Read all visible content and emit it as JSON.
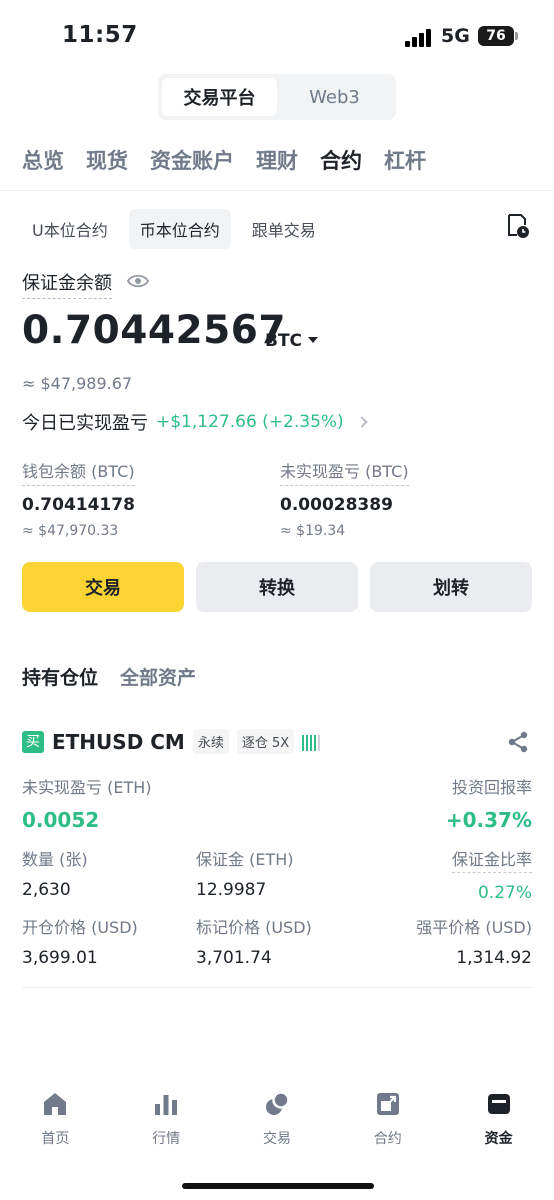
{
  "status_bar": {
    "time": "11:57",
    "network": "5G",
    "battery": "76"
  },
  "platform_switch": {
    "tabs": [
      "交易平台",
      "Web3"
    ],
    "active": 0
  },
  "main_nav": {
    "items": [
      "总览",
      "现货",
      "资金账户",
      "理财",
      "合约",
      "杠杆"
    ],
    "active": 4
  },
  "sub_tabs": {
    "items": [
      "U本位合约",
      "币本位合约",
      "跟单交易"
    ],
    "active": 1
  },
  "balance": {
    "label": "保证金余额",
    "value": "0.70442567",
    "unit": "BTC",
    "usd_approx": "≈ $47,989.67",
    "pnl_label": "今日已实现盈亏",
    "pnl_value": "+$1,127.66 (+2.35%)"
  },
  "wallet": {
    "label": "钱包余额 (BTC)",
    "value": "0.70414178",
    "usd": "≈ $47,970.33"
  },
  "unrealized": {
    "label": "未实现盈亏 (BTC)",
    "value": "0.00028389",
    "usd": "≈ $19.34"
  },
  "actions": {
    "trade": "交易",
    "convert": "转换",
    "transfer": "划转"
  },
  "position_tabs": {
    "items": [
      "持有仓位",
      "全部资产"
    ],
    "active": 0
  },
  "position": {
    "side_badge": "买",
    "symbol": "ETHUSD CM",
    "type_tag": "永续",
    "margin_tag": "逐仓 5X",
    "unrealized_label": "未实现盈亏 (ETH)",
    "unrealized_value": "0.0052",
    "roi_label": "投资回报率",
    "roi_value": "+0.37%",
    "qty_label": "数量 (张)",
    "qty_value": "2,630",
    "margin_label": "保证金 (ETH)",
    "margin_value": "12.9987",
    "margin_ratio_label": "保证金比率",
    "margin_ratio_value": "0.27%",
    "entry_label": "开仓价格 (USD)",
    "entry_value": "3,699.01",
    "mark_label": "标记价格 (USD)",
    "mark_value": "3,701.74",
    "liq_label": "强平价格 (USD)",
    "liq_value": "1,314.92"
  },
  "bottom_nav": {
    "items": [
      {
        "label": "首页",
        "icon": "home-icon"
      },
      {
        "label": "行情",
        "icon": "markets-icon"
      },
      {
        "label": "交易",
        "icon": "trade-icon"
      },
      {
        "label": "合约",
        "icon": "futures-icon"
      },
      {
        "label": "资金",
        "icon": "wallet-icon"
      }
    ],
    "active": 4
  },
  "colors": {
    "accent": "#fcd535",
    "up": "#2ebd85",
    "text": "#1e2329",
    "muted": "#707a8a"
  }
}
